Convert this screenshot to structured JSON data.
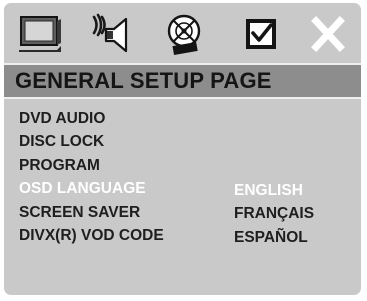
{
  "icons": [
    {
      "name": "general-setup-tv-icon",
      "selected": true
    },
    {
      "name": "audio-setup-speaker-icon",
      "selected": false
    },
    {
      "name": "video-setup-disc-icon",
      "selected": false
    },
    {
      "name": "preference-setup-checkbox-icon",
      "selected": false
    },
    {
      "name": "exit-close-icon",
      "selected": false
    }
  ],
  "page_title": "GENERAL SETUP PAGE",
  "menu": {
    "items": [
      {
        "label": "DVD AUDIO",
        "active": false
      },
      {
        "label": "DISC LOCK",
        "active": false
      },
      {
        "label": "PROGRAM",
        "active": false
      },
      {
        "label": "OSD LANGUAGE",
        "active": true
      },
      {
        "label": "SCREEN SAVER",
        "active": false
      },
      {
        "label": "DIVX(R) VOD CODE",
        "active": false
      }
    ]
  },
  "language_options": {
    "items": [
      {
        "label": "ENGLISH",
        "selected": true
      },
      {
        "label": "FRANÇAIS",
        "selected": false
      },
      {
        "label": "ESPAÑOL",
        "selected": false
      }
    ]
  },
  "colors": {
    "panel": "#c9c9c9",
    "title_bar": "#8d8d8d",
    "text": "#1e1e1e",
    "highlight": "#ffffff"
  }
}
